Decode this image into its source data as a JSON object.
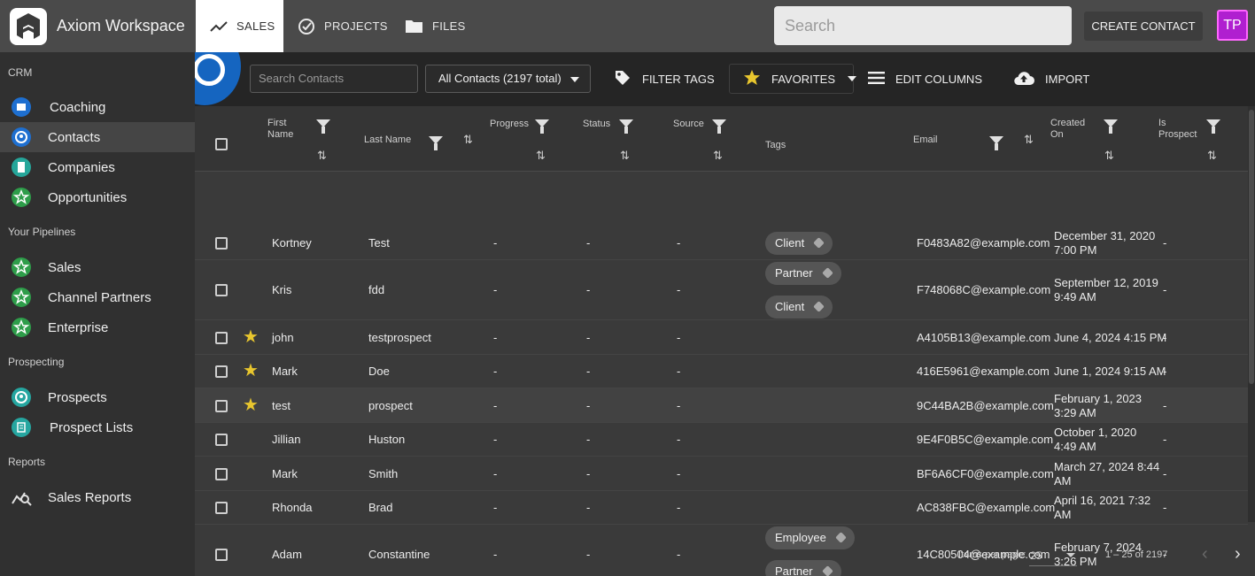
{
  "app": {
    "title": "Axiom Workspace"
  },
  "nav": {
    "tabs": [
      {
        "label": "SALES"
      },
      {
        "label": "PROJECTS"
      },
      {
        "label": "FILES"
      }
    ]
  },
  "header": {
    "search_placeholder": "Search",
    "create_label": "CREATE CONTACT",
    "avatar_initials": "TP"
  },
  "sidebar": {
    "sections": [
      {
        "label": "CRM",
        "items": [
          {
            "label": "Coaching"
          },
          {
            "label": "Contacts"
          },
          {
            "label": "Companies"
          },
          {
            "label": "Opportunities"
          }
        ]
      },
      {
        "label": "Your Pipelines",
        "items": [
          {
            "label": "Sales"
          },
          {
            "label": "Channel Partners"
          },
          {
            "label": "Enterprise"
          }
        ]
      },
      {
        "label": "Prospecting",
        "items": [
          {
            "label": "Prospects"
          },
          {
            "label": "Prospect Lists"
          }
        ]
      },
      {
        "label": "Reports",
        "items": [
          {
            "label": "Sales Reports"
          }
        ]
      }
    ]
  },
  "toolbar": {
    "search_placeholder": "Search Contacts",
    "view_selected": "All Contacts (2197 total)",
    "filter_tags": "FILTER TAGS",
    "favorites": "FAVORITES",
    "edit_columns": "EDIT COLUMNS",
    "import": "IMPORT"
  },
  "table": {
    "headers": {
      "first_name": [
        "First",
        "Name"
      ],
      "last_name": "Last Name",
      "progress": "Progress",
      "status": "Status",
      "source": "Source",
      "tags": "Tags",
      "email": "Email",
      "created_on": [
        "Created",
        "On"
      ],
      "is_prospect": [
        "Is",
        "Prospect"
      ]
    },
    "rows": [
      {
        "favorite": false,
        "first": "Kortney",
        "last": "Test",
        "progress": "-",
        "status": "-",
        "source": "-",
        "tags": [
          "Client"
        ],
        "email": "F0483A82@example.com",
        "created": [
          "December 31, 2020",
          "7:00 PM"
        ],
        "prospect": "-"
      },
      {
        "favorite": false,
        "first": "Kris",
        "last": "fdd",
        "progress": "-",
        "status": "-",
        "source": "-",
        "tags": [
          "Partner",
          "Client"
        ],
        "email": "F748068C@example.com",
        "created": [
          "September 12, 2019",
          "9:49 AM"
        ],
        "prospect": "-"
      },
      {
        "favorite": true,
        "first": "john",
        "last": "testprospect",
        "progress": "-",
        "status": "-",
        "source": "-",
        "tags": [],
        "email": "A4105B13@example.com",
        "created": [
          "June 4, 2024 4:15 PM"
        ],
        "prospect": "-"
      },
      {
        "favorite": true,
        "first": "Mark",
        "last": "Doe",
        "progress": "-",
        "status": "-",
        "source": "-",
        "tags": [],
        "email": "416E5961@example.com",
        "created": [
          "June 1, 2024 9:15 AM"
        ],
        "prospect": "-"
      },
      {
        "favorite": true,
        "first": "test",
        "last": "prospect",
        "progress": "-",
        "status": "-",
        "source": "-",
        "tags": [],
        "email": "9C44BA2B@example.com",
        "created": [
          "February 1, 2023",
          "3:29 AM"
        ],
        "prospect": "-"
      },
      {
        "favorite": false,
        "first": "Jillian",
        "last": "Huston",
        "progress": "-",
        "status": "-",
        "source": "-",
        "tags": [],
        "email": "9E4F0B5C@example.com",
        "created": [
          "October 1, 2020",
          "4:49 AM"
        ],
        "prospect": "-"
      },
      {
        "favorite": false,
        "first": "Mark",
        "last": "Smith",
        "progress": "-",
        "status": "-",
        "source": "-",
        "tags": [],
        "email": "BF6A6CF0@example.com",
        "created": [
          "March 27, 2024 8:44",
          "AM"
        ],
        "prospect": "-"
      },
      {
        "favorite": false,
        "first": "Rhonda",
        "last": "Brad",
        "progress": "-",
        "status": "-",
        "source": "-",
        "tags": [],
        "email": "AC838FBC@example.com",
        "created": [
          "April 16, 2021 7:32",
          "AM"
        ],
        "prospect": "-"
      },
      {
        "favorite": false,
        "first": "Adam",
        "last": "Constantine",
        "progress": "-",
        "status": "-",
        "source": "-",
        "tags": [
          "Employee",
          "Partner"
        ],
        "email": "14C80504@example.com",
        "created": [
          "February 7, 2024",
          "3:26 PM"
        ],
        "prospect": "-"
      }
    ]
  },
  "footer": {
    "items_per_page_label": "Items per page:",
    "items_per_page": "25",
    "range": "1 – 25 of 2197"
  },
  "colors": {
    "accent_avatar": "#b01fd0",
    "star": "#e8c62e",
    "brand_blue": "#1565c0"
  }
}
